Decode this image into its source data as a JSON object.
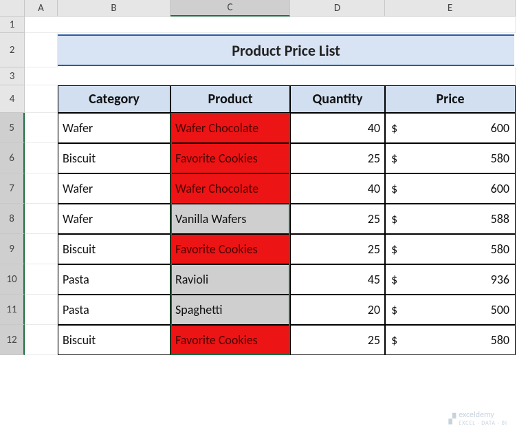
{
  "columns": [
    "A",
    "B",
    "C",
    "D",
    "E"
  ],
  "rows": [
    "1",
    "2",
    "3",
    "4",
    "5",
    "6",
    "7",
    "8",
    "9",
    "10",
    "11",
    "12"
  ],
  "activeColumn": "C",
  "selectedRows": [
    "5",
    "6",
    "7",
    "8",
    "9",
    "10",
    "11",
    "12"
  ],
  "title": "Product Price List",
  "headers": {
    "category": "Category",
    "product": "Product",
    "quantity": "Quantity",
    "price": "Price"
  },
  "currency": "$",
  "data": [
    {
      "category": "Wafer",
      "product": "Wafer Chocolate",
      "qty": "40",
      "price": "600",
      "hl": "red"
    },
    {
      "category": "Biscuit",
      "product": "Favorite Cookies",
      "qty": "25",
      "price": "580",
      "hl": "red"
    },
    {
      "category": "Wafer",
      "product": "Wafer Chocolate",
      "qty": "40",
      "price": "600",
      "hl": "red"
    },
    {
      "category": "Wafer",
      "product": "Vanilla Wafers",
      "qty": "25",
      "price": "588",
      "hl": "grey"
    },
    {
      "category": "Biscuit",
      "product": "Favorite Cookies",
      "qty": "25",
      "price": "580",
      "hl": "red"
    },
    {
      "category": "Pasta",
      "product": "Ravioli",
      "qty": "45",
      "price": "936",
      "hl": "grey"
    },
    {
      "category": "Pasta",
      "product": "Spaghetti",
      "qty": "20",
      "price": "500",
      "hl": "grey"
    },
    {
      "category": "Biscuit",
      "product": "Favorite Cookies",
      "qty": "25",
      "price": "580",
      "hl": "red"
    }
  ],
  "watermark": {
    "brand": "exceldemy",
    "sub": "EXCEL · DATA · BI"
  }
}
